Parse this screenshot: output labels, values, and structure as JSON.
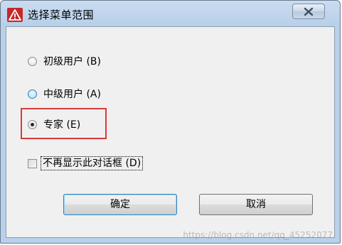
{
  "window": {
    "title": "选择菜单范围"
  },
  "options": [
    {
      "label": "初级用户 (B)",
      "checked": false
    },
    {
      "label": "中级用户 (A)",
      "checked": false
    },
    {
      "label": "专家 (E)",
      "checked": true
    }
  ],
  "checkbox": {
    "label": "不再显示此对话框 (D)",
    "checked": false
  },
  "buttons": {
    "ok_label": "确定",
    "cancel_label": "取消"
  },
  "watermark": "https://blog.csdn.net/qq_45252077",
  "colors": {
    "highlight": "#d63b3b",
    "titlebar": "#c9dcf0",
    "dialog_bg": "#f0f0f0"
  },
  "icons": {
    "title": "warning-triangle-icon",
    "close": "close-icon"
  }
}
